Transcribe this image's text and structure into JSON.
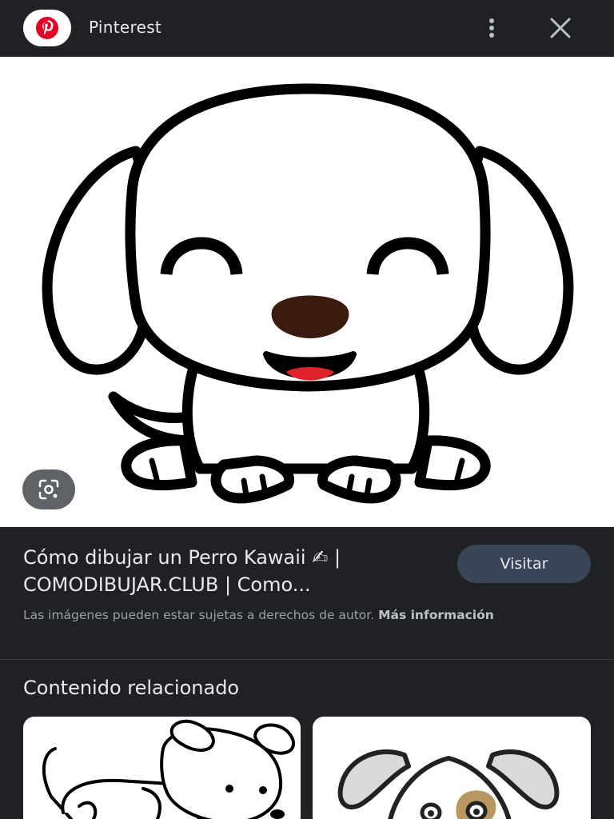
{
  "header": {
    "site_name": "Pinterest",
    "logo_letter": "p",
    "menu_icon": "more-vert-icon",
    "close_icon": "close-icon"
  },
  "image": {
    "lens_icon": "google-lens-icon"
  },
  "result": {
    "title_line1": "Cómo dibujar un Perro Kawaii ✍ |",
    "title_line2": "COMODIBUJAR.CLUB | Como...",
    "visit_label": "Visitar",
    "copyright_text": "Las imágenes pueden estar sujetas a derechos de autor.",
    "more_info_label": "Más información"
  },
  "related": {
    "title": "Contenido relacionado"
  },
  "colors": {
    "background": "#202124",
    "pinterest_red": "#e60023",
    "visit_button": "#394457",
    "nose_brown": "#3b1a10",
    "tongue_red": "#e0202a"
  }
}
